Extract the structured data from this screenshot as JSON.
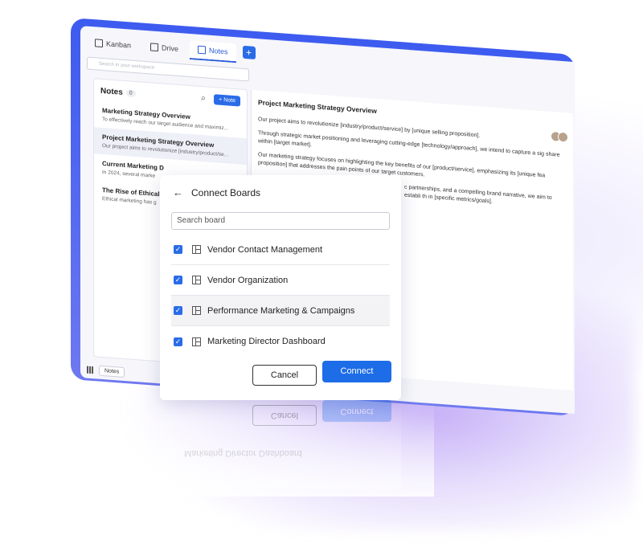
{
  "app": {
    "tabs": [
      {
        "label": "Kanban",
        "icon": "kanban-icon"
      },
      {
        "label": "Drive",
        "icon": "drive-icon"
      },
      {
        "label": "Notes",
        "icon": "notes-icon",
        "active": true
      }
    ],
    "add_tab_label": "+",
    "search_placeholder": "Search in your workspace"
  },
  "sidebar": {
    "title": "Notes",
    "count": "0",
    "new_button": "+ Note",
    "items": [
      {
        "title": "Marketing Strategy Overview",
        "snippet": "To effectively reach our target audience and maximiz..."
      },
      {
        "title": "Project Marketing Strategy Overview",
        "snippet": "Our project aims to revolutionize [industry/product/se...",
        "selected": true
      },
      {
        "title": "Current Marketing D",
        "snippet": "In 2024, several marke"
      },
      {
        "title": "The Rise of Ethical",
        "snippet": "Ethical marketing has g"
      }
    ]
  },
  "editor": {
    "title": "Project Marketing Strategy Overview",
    "paragraphs": [
      "Our project aims to revolutionize [industry/product/service] by [unique selling proposition].",
      "Through strategic market positioning and leveraging cutting-edge [technology/approach], we intend to capture a sig share within [target market].",
      "Our marketing strategy focuses on highlighting the key benefits of our [product/service], emphasizing its [unique fea proposition] that addresses the pain points of our target customers.",
      "c partnerships, and a compelling brand narrative, we aim to establi th in [specific metrics/goals]."
    ]
  },
  "footer": {
    "notes_tab": "Notes"
  },
  "modal": {
    "title": "Connect Boards",
    "search_placeholder": "Search board",
    "boards": [
      {
        "label": "Vendor Contact Management",
        "checked": true
      },
      {
        "label": "Vendor Organization",
        "checked": true
      },
      {
        "label": "Performance Marketing & Campaigns",
        "checked": true
      },
      {
        "label": "Marketing Director Dashboard",
        "checked": true
      }
    ],
    "cancel_label": "Cancel",
    "connect_label": "Connect"
  },
  "colors": {
    "accent": "#1d6ce8",
    "frame": "#3d5bef",
    "glow": "#9a76f0"
  }
}
